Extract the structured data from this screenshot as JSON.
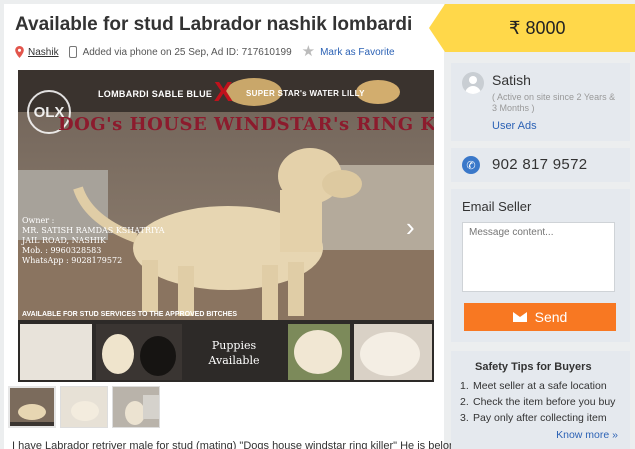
{
  "ad": {
    "title": "Available for stud Labrador nashik lombardi",
    "location": "Nashik",
    "added_info": "Added via phone on 25 Sep, Ad ID: 717610199",
    "favorite_label": "Mark as Favorite",
    "description": "I have Labrador retriver male for stud (mating) \"Dogs house windstar ring killer\" He is belong"
  },
  "photo": {
    "logo": "OLX",
    "top_left_text": "LOMBARDI SABLE BLUE",
    "cross": "X",
    "top_right_text": "SUPER STAR's WATER LILLY",
    "banner": "DOG's HOUSE WINDSTAR's RING KILLER",
    "contact_lines": [
      "Owner :",
      "MR. SATISH RAMDAS KSHATRIYA",
      "JAIL ROAD, NASHIK",
      "Mob.      : 9960328583",
      "WhatsApp : 9028179572"
    ],
    "stud_text": "AVAILABLE FOR STUD SERVICES TO THE APPROVED BITCHES",
    "puppies_line1": "Puppies",
    "puppies_line2": "Available",
    "next_icon": "chevron-right-icon"
  },
  "price": {
    "currency": "₹",
    "amount": "8000"
  },
  "seller": {
    "name": "Satish",
    "active_since": "( Active on site since 2 Years & 3 Months )",
    "user_ads_label": "User Ads"
  },
  "phone": {
    "number": "902 817 9572"
  },
  "email": {
    "title": "Email Seller",
    "placeholder": "Message content...",
    "send_label": "Send"
  },
  "tips": {
    "title": "Safety Tips for Buyers",
    "items": [
      {
        "n": "1.",
        "text": "Meet seller at a safe location"
      },
      {
        "n": "2.",
        "text": "Check the item before you buy"
      },
      {
        "n": "3.",
        "text": "Pay only after collecting item"
      }
    ],
    "more_label": "Know more »"
  },
  "colors": {
    "price_bg": "#ffd84a",
    "send_button": "#f87822",
    "link": "#2c62b5",
    "card_bg": "#e5e9ee",
    "banner_text": "#8c1b2d"
  }
}
